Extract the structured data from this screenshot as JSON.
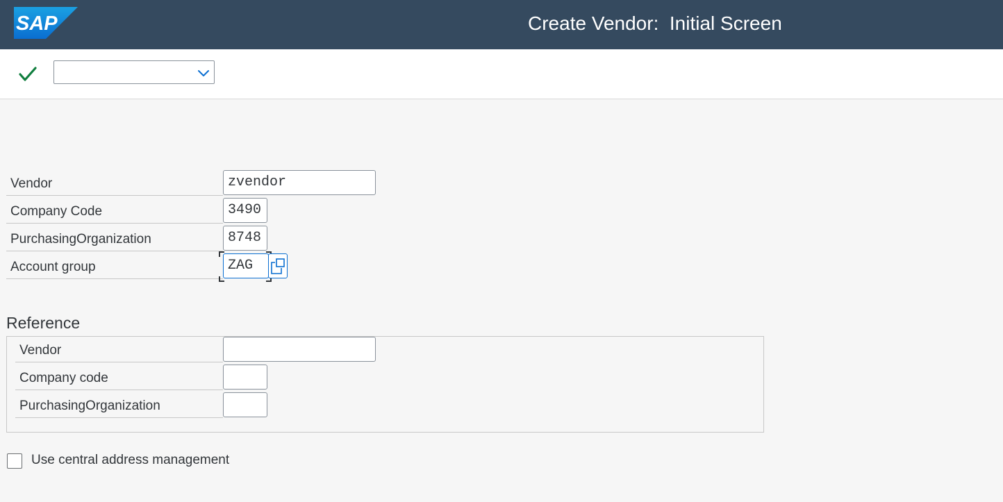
{
  "header": {
    "logo_text": "SAP",
    "title": "Create Vendor:  Initial Screen"
  },
  "toolbar": {
    "command_field_value": ""
  },
  "main": {
    "fields": [
      {
        "label": "Vendor",
        "value": "zvendor"
      },
      {
        "label": "Company Code",
        "value": "3490"
      },
      {
        "label": "PurchasingOrganization",
        "value": "8748"
      },
      {
        "label": "Account group",
        "value": "ZAG"
      }
    ]
  },
  "reference": {
    "title": "Reference",
    "fields": [
      {
        "label": "Vendor",
        "value": ""
      },
      {
        "label": "Company code",
        "value": ""
      },
      {
        "label": "PurchasingOrganization",
        "value": ""
      }
    ]
  },
  "options": {
    "central_address_label": "Use central address management",
    "central_address_checked": false
  },
  "colors": {
    "shell_header": "#354a5f",
    "sap_logo_blue": "#0a6ed1",
    "check_green": "#107e3e",
    "focus_blue": "#0a6ed1"
  }
}
